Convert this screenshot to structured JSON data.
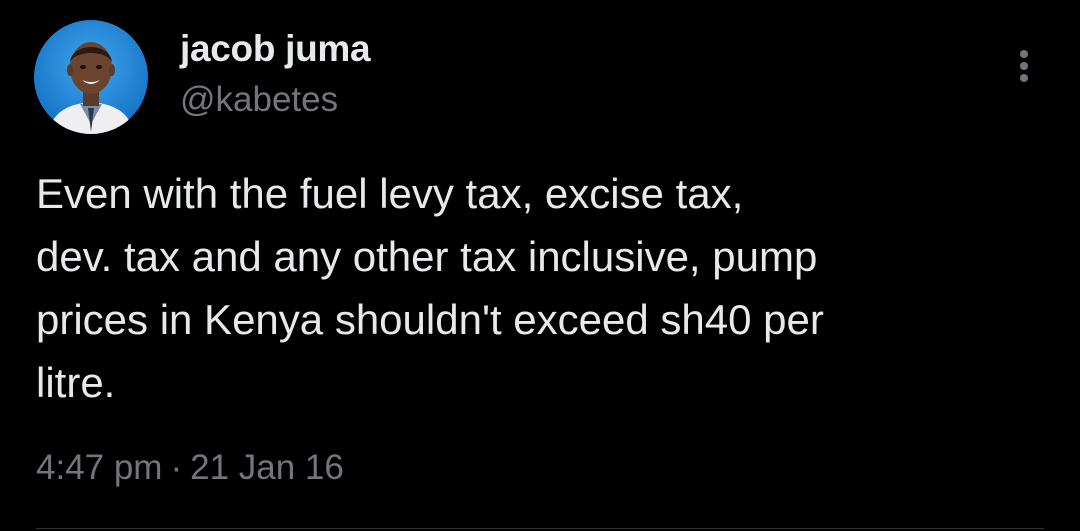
{
  "tweet": {
    "author": {
      "display_name": "jacob juma",
      "handle": "@kabetes"
    },
    "text": "Even with the fuel levy tax, excise tax,\ndev. tax and any other tax inclusive, pump\nprices in Kenya shouldn't exceed sh40 per\nlitre.",
    "time": "4:47 pm",
    "separator": "·",
    "date": "21 Jan 16"
  },
  "icons": {
    "more": "more-options-icon"
  },
  "colors": {
    "background": "#000000",
    "primary_text": "#e7e9ea",
    "secondary_text": "#71767b",
    "avatar_ring": "#1d8fe0"
  }
}
